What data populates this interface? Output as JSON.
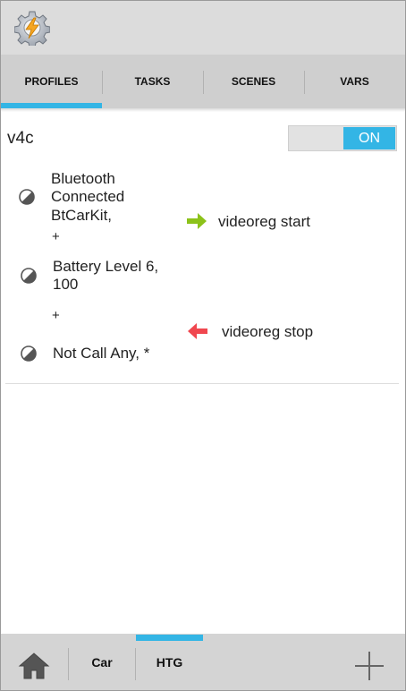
{
  "app_icon": "tasker-gear-lightning-icon",
  "tabs": [
    {
      "label": "PROFILES",
      "active": true
    },
    {
      "label": "TASKS",
      "active": false
    },
    {
      "label": "SCENES",
      "active": false
    },
    {
      "label": "VARS",
      "active": false
    }
  ],
  "profile": {
    "name": "v4c",
    "toggle_label": "ON",
    "contexts": [
      {
        "line1": "Bluetooth",
        "line2": "Connected",
        "line3": "BtCarKit,",
        "icon": "half-circle-icon"
      },
      {
        "line1": "Battery Level 6,",
        "line2": "100",
        "icon": "half-circle-icon"
      },
      {
        "line1": "Not Call Any, *",
        "icon": "half-circle-icon"
      }
    ],
    "plus_1": "+",
    "plus_2": "+",
    "enter_task": "videoreg start",
    "exit_task": "videoreg stop"
  },
  "bottom": {
    "home_icon": "home-icon",
    "projects": [
      {
        "label": "Car",
        "active": false
      },
      {
        "label": "HTG",
        "active": true
      }
    ],
    "add_icon": "plus-icon"
  },
  "colors": {
    "accent": "#33b5e5",
    "enter_arrow": "#8cc21a",
    "exit_arrow": "#f0474f",
    "tabbar": "#cfcfcf",
    "actionbar": "#dcdcdc"
  }
}
